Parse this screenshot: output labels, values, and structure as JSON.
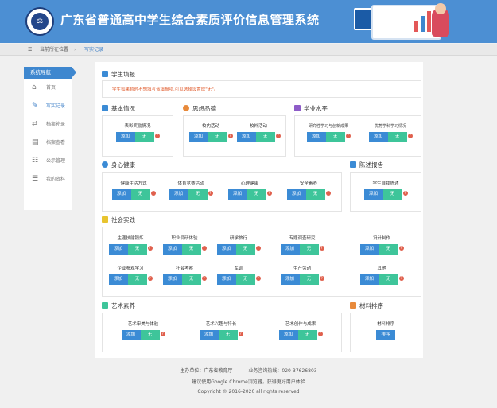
{
  "header": {
    "title": "广东省普通高中学生综合素质评价信息管理系统",
    "logo_text": "⚖"
  },
  "breadcrumb": {
    "location_label": "当前所在位置",
    "separator": "›",
    "current": "写实记录"
  },
  "sidebar": {
    "heading": "系统导航",
    "items": [
      {
        "label": "首页",
        "icon": "home-icon",
        "glyph": "⌂"
      },
      {
        "label": "写实记录",
        "icon": "edit-icon",
        "glyph": "✎"
      },
      {
        "label": "档案补录",
        "icon": "swap-icon",
        "glyph": "⇄"
      },
      {
        "label": "档案查看",
        "icon": "archive-icon",
        "glyph": "▤"
      },
      {
        "label": "公示管理",
        "icon": "document-icon",
        "glyph": "☷"
      },
      {
        "label": "我的资料",
        "icon": "profile-icon",
        "glyph": "☰"
      }
    ]
  },
  "main": {
    "title": "学生填报",
    "notice": "学生如果暂时不想填写该填报项,可以选择设置成\"无\"。",
    "add_label": "添加",
    "none_label": "无",
    "help_label": "?",
    "sort_label": "排序",
    "sections": {
      "basic": {
        "title": "基本情况",
        "items": [
          "表彰奖励情况"
        ]
      },
      "moral": {
        "title": "思想品德",
        "items": [
          "校内活动",
          "校外活动"
        ]
      },
      "academic": {
        "title": "学业水平",
        "items": [
          "研究性学习与创新成果",
          "优势学科学习情况"
        ]
      },
      "health": {
        "title": "身心健康",
        "items": [
          "健康生活方式",
          "体育竞赛活动",
          "心理健康",
          "安全素养"
        ]
      },
      "report": {
        "title": "陈述报告",
        "items": [
          "学生自我陈述"
        ]
      },
      "social": {
        "title": "社会实践",
        "items": [
          "生涯技能锻炼",
          "职业调研体验",
          "研学旅行",
          "专题调查研究",
          "设计制作",
          "企业参观学习",
          "社会考察",
          "军训",
          "生产劳动",
          "其他"
        ]
      },
      "art": {
        "title": "艺术素养",
        "items": [
          "艺术审美与体验",
          "艺术兴趣与特长",
          "艺术创作与成果"
        ]
      },
      "material": {
        "title": "材料排序",
        "items": [
          "材料排序"
        ]
      }
    }
  },
  "footer": {
    "host": "主办单位：广东省教育厅",
    "hotline": "业务咨询热线：020-37626803",
    "browser_tip": "建议使用Google Chrome浏览器，获得更好用户体验",
    "copyright": "Copyright © 2016-2020 all rights reserved"
  },
  "colors": {
    "header_bg": "#4c8fd3",
    "add_button": "#3b8bd5",
    "none_button": "#3ec59a",
    "help_badge": "#e0604d",
    "notice_text": "#e05a2b"
  }
}
